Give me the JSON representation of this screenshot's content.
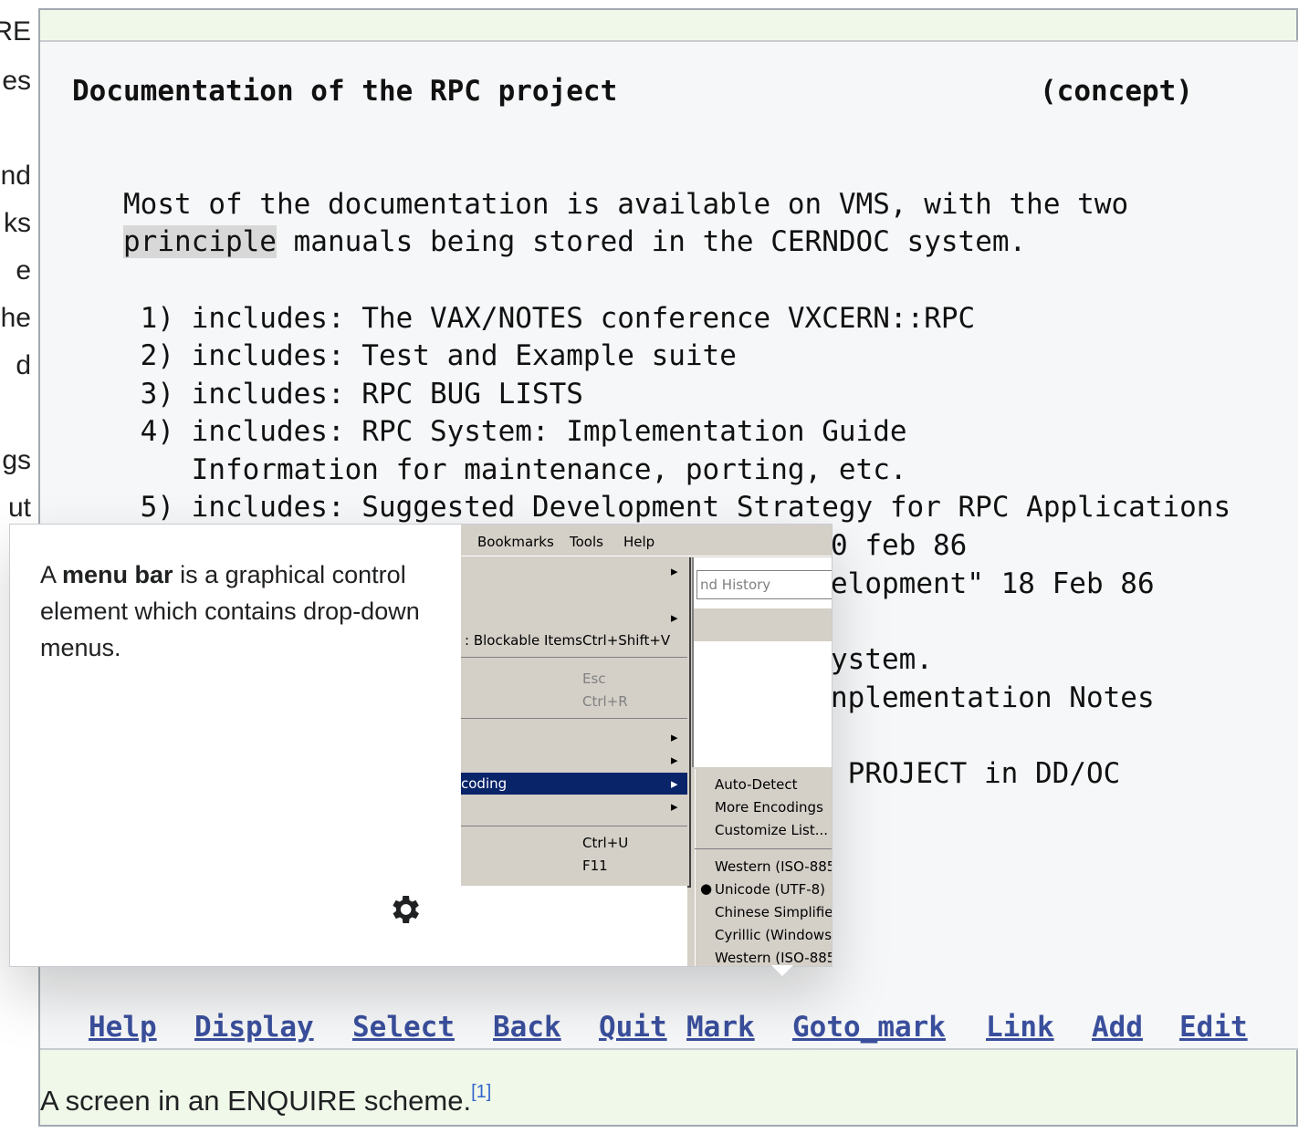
{
  "left_fragments": [
    "RE",
    "es",
    "nd",
    "ks",
    "e",
    "he",
    "d",
    "gs",
    "ut"
  ],
  "screen": {
    "title": "Documentation of the RPC project",
    "status": "(concept)",
    "para_line1": "Most of the documentation is available on VMS, with the two",
    "para_hl": "principle",
    "para_line2_rest": " manuals being stored in the CERNDOC system.",
    "items": [
      " 1) includes: The VAX/NOTES conference VXCERN::RPC",
      " 2) includes: Test and Example suite",
      " 3) includes: RPC BUG LISTS",
      " 4) includes: RPC System: Implementation Guide",
      "    Information for maintenance, porting, etc.",
      " 5) includes: Suggested Development Strategy for RPC Applications"
    ],
    "behind_fragments": [
      "0 feb 86",
      "elopment\" 18 Feb 86",
      "ystem.",
      "nplementation Notes",
      " PROJECT in DD/OC"
    ],
    "commands": [
      "Help",
      "Display",
      "Select",
      "Back",
      "Quit",
      "Mark",
      "Goto_mark",
      "Link",
      "Add",
      "Edit"
    ]
  },
  "caption": "A screen in an ENQUIRE scheme.",
  "caption_ref": "[1]",
  "popup": {
    "text_pre": "A ",
    "text_bold": "menu bar",
    "text_post": " is a graphical control element which contains drop-down menus.",
    "settings_icon": "gear-icon"
  },
  "menu_image": {
    "menubar": [
      "Bookmarks",
      "Tools",
      "Help"
    ],
    "history_field": "nd History",
    "menu_items": [
      {
        "label": ": Blockable Items",
        "shortcut": "Ctrl+Shift+V"
      },
      {
        "label": "",
        "shortcut": "Esc"
      },
      {
        "label": "",
        "shortcut": "Ctrl+R"
      },
      {
        "label": "coding",
        "shortcut": ""
      },
      {
        "label": "",
        "shortcut": "Ctrl+U"
      },
      {
        "label": "",
        "shortcut": "F11"
      }
    ],
    "submenu": [
      "Auto-Detect",
      "More Encodings",
      "Customize List...",
      "Western (ISO-885",
      "Unicode (UTF-8)",
      "Chinese Simplified",
      "Cyrillic (Windows-:",
      "Western (ISO-885"
    ],
    "selected_color": "#0a246a"
  }
}
